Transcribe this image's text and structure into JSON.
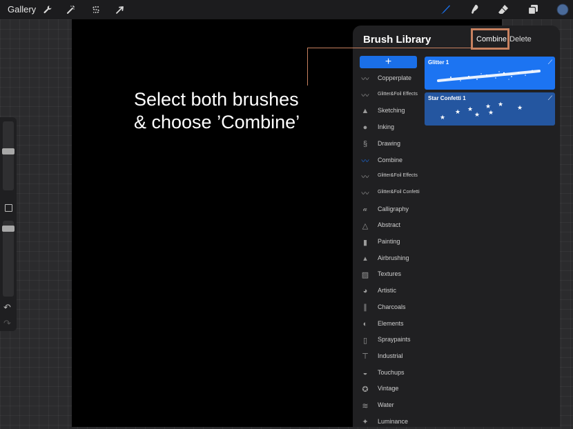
{
  "topbar": {
    "gallery_label": "Gallery",
    "left_tools": [
      "wrench-icon",
      "magic-wand-icon",
      "selection-s-icon",
      "arrow-cursor-icon"
    ],
    "right_tools": [
      "brush-icon",
      "smudge-icon",
      "eraser-icon",
      "layers-icon",
      "color-swatch-icon"
    ],
    "accent_color": "#1a6fe8",
    "swatch_color": "#4a6a99"
  },
  "instruction": {
    "line1": "Select both brushes",
    "line2": "& choose ’Combine’",
    "callout_color": "#c8815f"
  },
  "panel": {
    "title": "Brush Library",
    "combine_label": "Combine",
    "delete_label": "Delete",
    "add_label": "+"
  },
  "categories": [
    {
      "label": "Copperplate",
      "icon": "copperplate-icon"
    },
    {
      "label": "Glitter&Foil Effects",
      "icon": "glitter-foil-icon"
    },
    {
      "label": "Sketching",
      "icon": "sketching-icon"
    },
    {
      "label": "Inking",
      "icon": "inking-icon"
    },
    {
      "label": "Drawing",
      "icon": "drawing-icon"
    },
    {
      "label": "Combine",
      "icon": "combine-icon"
    },
    {
      "label": "Glitter&Foil Effects",
      "icon": "glitter-foil-icon"
    },
    {
      "label": "Glitter&Foil Confetti",
      "icon": "glitter-confetti-icon"
    },
    {
      "label": "Calligraphy",
      "icon": "calligraphy-icon"
    },
    {
      "label": "Abstract",
      "icon": "abstract-icon"
    },
    {
      "label": "Painting",
      "icon": "painting-icon"
    },
    {
      "label": "Airbrushing",
      "icon": "airbrushing-icon"
    },
    {
      "label": "Textures",
      "icon": "textures-icon"
    },
    {
      "label": "Artistic",
      "icon": "artistic-icon"
    },
    {
      "label": "Charcoals",
      "icon": "charcoals-icon"
    },
    {
      "label": "Elements",
      "icon": "elements-icon"
    },
    {
      "label": "Spraypaints",
      "icon": "spraypaints-icon"
    },
    {
      "label": "Industrial",
      "icon": "industrial-icon"
    },
    {
      "label": "Touchups",
      "icon": "touchups-icon"
    },
    {
      "label": "Vintage",
      "icon": "vintage-icon"
    },
    {
      "label": "Water",
      "icon": "water-icon"
    },
    {
      "label": "Luminance",
      "icon": "luminance-icon"
    }
  ],
  "brushes": [
    {
      "name": "Glitter 1",
      "selected": true,
      "color": "#1c74f2"
    },
    {
      "name": "Star Confetti 1",
      "selected": true,
      "color": "#2456a0"
    }
  ]
}
